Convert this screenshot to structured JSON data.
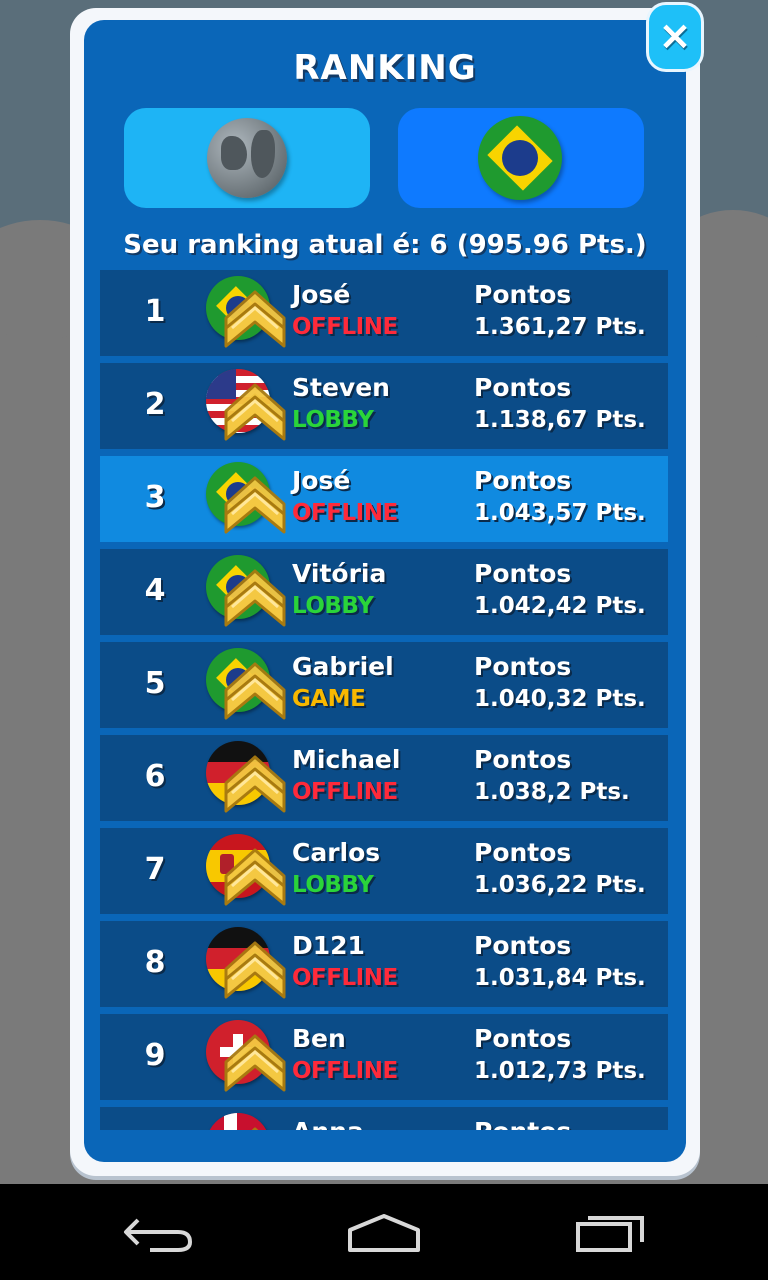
{
  "modal": {
    "title": "RANKING",
    "close_label": "×",
    "tabs": [
      {
        "id": "world",
        "icon": "globe-icon",
        "active": false
      },
      {
        "id": "country",
        "icon": "brazil-flag-icon",
        "active": true
      }
    ],
    "current_ranking_text": "Seu ranking atual é: 6 (995.96 Pts.)"
  },
  "rows": [
    {
      "rank": "1",
      "flag": "BR",
      "name": "José",
      "status": "OFFLINE",
      "status_type": "offline",
      "points_label": "Pontos",
      "points": "1.361,27 Pts.",
      "highlight": false
    },
    {
      "rank": "2",
      "flag": "US",
      "name": "Steven",
      "status": "LOBBY",
      "status_type": "lobby",
      "points_label": "Pontos",
      "points": "1.138,67 Pts.",
      "highlight": false
    },
    {
      "rank": "3",
      "flag": "BR",
      "name": "José",
      "status": "OFFLINE",
      "status_type": "offline",
      "points_label": "Pontos",
      "points": "1.043,57 Pts.",
      "highlight": true
    },
    {
      "rank": "4",
      "flag": "BR",
      "name": "Vitória",
      "status": "LOBBY",
      "status_type": "lobby",
      "points_label": "Pontos",
      "points": "1.042,42 Pts.",
      "highlight": false
    },
    {
      "rank": "5",
      "flag": "BR",
      "name": "Gabriel",
      "status": "GAME",
      "status_type": "game",
      "points_label": "Pontos",
      "points": "1.040,32 Pts.",
      "highlight": false
    },
    {
      "rank": "6",
      "flag": "DE",
      "name": "Michael",
      "status": "OFFLINE",
      "status_type": "offline",
      "points_label": "Pontos",
      "points": "1.038,2 Pts.",
      "highlight": false
    },
    {
      "rank": "7",
      "flag": "ES",
      "name": "Carlos",
      "status": "LOBBY",
      "status_type": "lobby",
      "points_label": "Pontos",
      "points": "1.036,22 Pts.",
      "highlight": false
    },
    {
      "rank": "8",
      "flag": "DE",
      "name": "D121",
      "status": "OFFLINE",
      "status_type": "offline",
      "points_label": "Pontos",
      "points": "1.031,84 Pts.",
      "highlight": false
    },
    {
      "rank": "9",
      "flag": "CH",
      "name": "Ben",
      "status": "OFFLINE",
      "status_type": "offline",
      "points_label": "Pontos",
      "points": "1.012,73 Pts.",
      "highlight": false
    },
    {
      "rank": "",
      "flag": "NO",
      "name": "Anna",
      "status": "",
      "status_type": "offline",
      "points_label": "Pontos",
      "points": "",
      "highlight": false
    }
  ],
  "navbar": {
    "buttons": [
      "back-icon",
      "home-icon",
      "recent-apps-icon"
    ]
  },
  "colors": {
    "panel": "#0a66b8",
    "row": "#0b4c88",
    "row_highlight": "#108ae0",
    "offline": "#ff2a3a",
    "lobby": "#2ad43a",
    "game": "#f8b800"
  }
}
